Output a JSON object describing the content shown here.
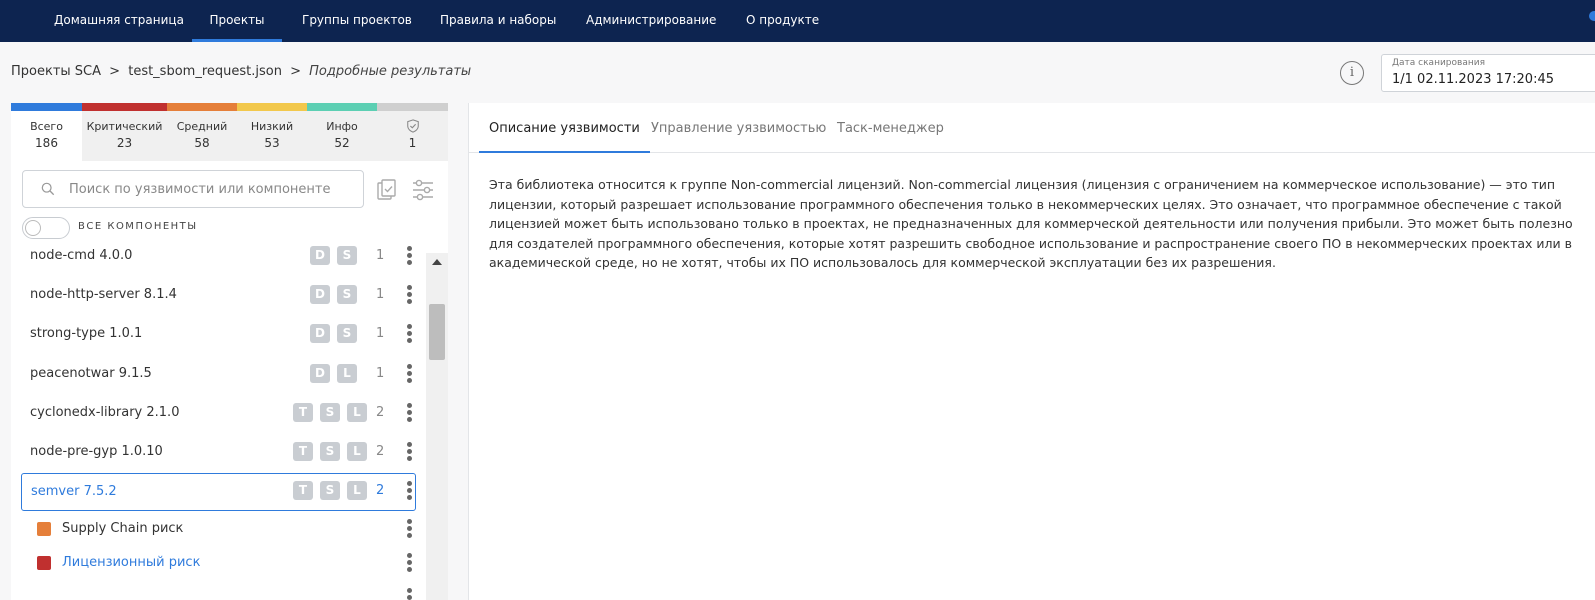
{
  "nav": {
    "items": [
      "Домашняя страница",
      "Проекты",
      "Группы проектов",
      "Правила и наборы",
      "Администрирование",
      "О продукте"
    ],
    "active_index": 1
  },
  "breadcrumb": {
    "items": [
      "Проекты SCA",
      "test_sbom_request.json",
      "Подробные результаты"
    ],
    "separator": ">"
  },
  "scan_date": {
    "label": "Дата сканирования",
    "value": "1/1 02.11.2023 17:20:45"
  },
  "severity": {
    "colors": [
      "#2f7bdc",
      "#c0302f",
      "#e57f3a",
      "#f2c84c",
      "#5ccfb3",
      "#cfcfcf"
    ],
    "tabs": [
      {
        "label": "Всего",
        "count": "186"
      },
      {
        "label": "Критический",
        "count": "23"
      },
      {
        "label": "Средний",
        "count": "58"
      },
      {
        "label": "Низкий",
        "count": "53"
      },
      {
        "label": "Инфо",
        "count": "52"
      },
      {
        "label": "",
        "count": "1",
        "icon": "shield-check-icon"
      }
    ]
  },
  "search": {
    "placeholder": "Поиск по уязвимости или компоненте",
    "value": ""
  },
  "toggle": {
    "label": "ВСЕ КОМПОНЕНТЫ",
    "on": false
  },
  "components": [
    {
      "name": "node-cmd 4.0.0",
      "badges": [
        "D",
        "S"
      ],
      "count": "1"
    },
    {
      "name": "node-http-server 8.1.4",
      "badges": [
        "D",
        "S"
      ],
      "count": "1"
    },
    {
      "name": "strong-type 1.0.1",
      "badges": [
        "D",
        "S"
      ],
      "count": "1"
    },
    {
      "name": "peacenotwar 9.1.5",
      "badges": [
        "D",
        "L"
      ],
      "count": "1"
    },
    {
      "name": "cyclonedx-library 2.1.0",
      "badges": [
        "T",
        "S",
        "L"
      ],
      "count": "2"
    },
    {
      "name": "node-pre-gyp 1.0.10",
      "badges": [
        "T",
        "S",
        "L"
      ],
      "count": "2"
    },
    {
      "name": "semver 7.5.2",
      "badges": [
        "T",
        "S",
        "L"
      ],
      "count": "2",
      "selected": true
    }
  ],
  "risks": [
    {
      "label": "Supply Chain риск",
      "color": "#e57f3a",
      "active": false
    },
    {
      "label": "Лицензионный риск",
      "color": "#c0302f",
      "active": true
    }
  ],
  "detail_tabs": [
    "Описание уязвимости",
    "Управление уязвимостью",
    "Таск-менеджер"
  ],
  "detail_active_index": 0,
  "description": "Эта библиотека относится к группе Non-commercial лицензий. Non-commercial лицензия (лицензия с ограничением на коммерческое использование) — это тип лицензии, который разрешает использование программного обеспечения только в некоммерческих целях. Это означает, что программное обеспечение с такой лицензией может быть использовано только в проектах, не предназначенных для коммерческой деятельности или получения прибыли. Это может быть полезно для создателей программного обеспечения, которые хотят разрешить свободное использование и распространение своего ПО в некоммерческих проектах или в академической среде, но не хотят, чтобы их ПО использовалось для коммерческой эксплуатации без их разрешения."
}
